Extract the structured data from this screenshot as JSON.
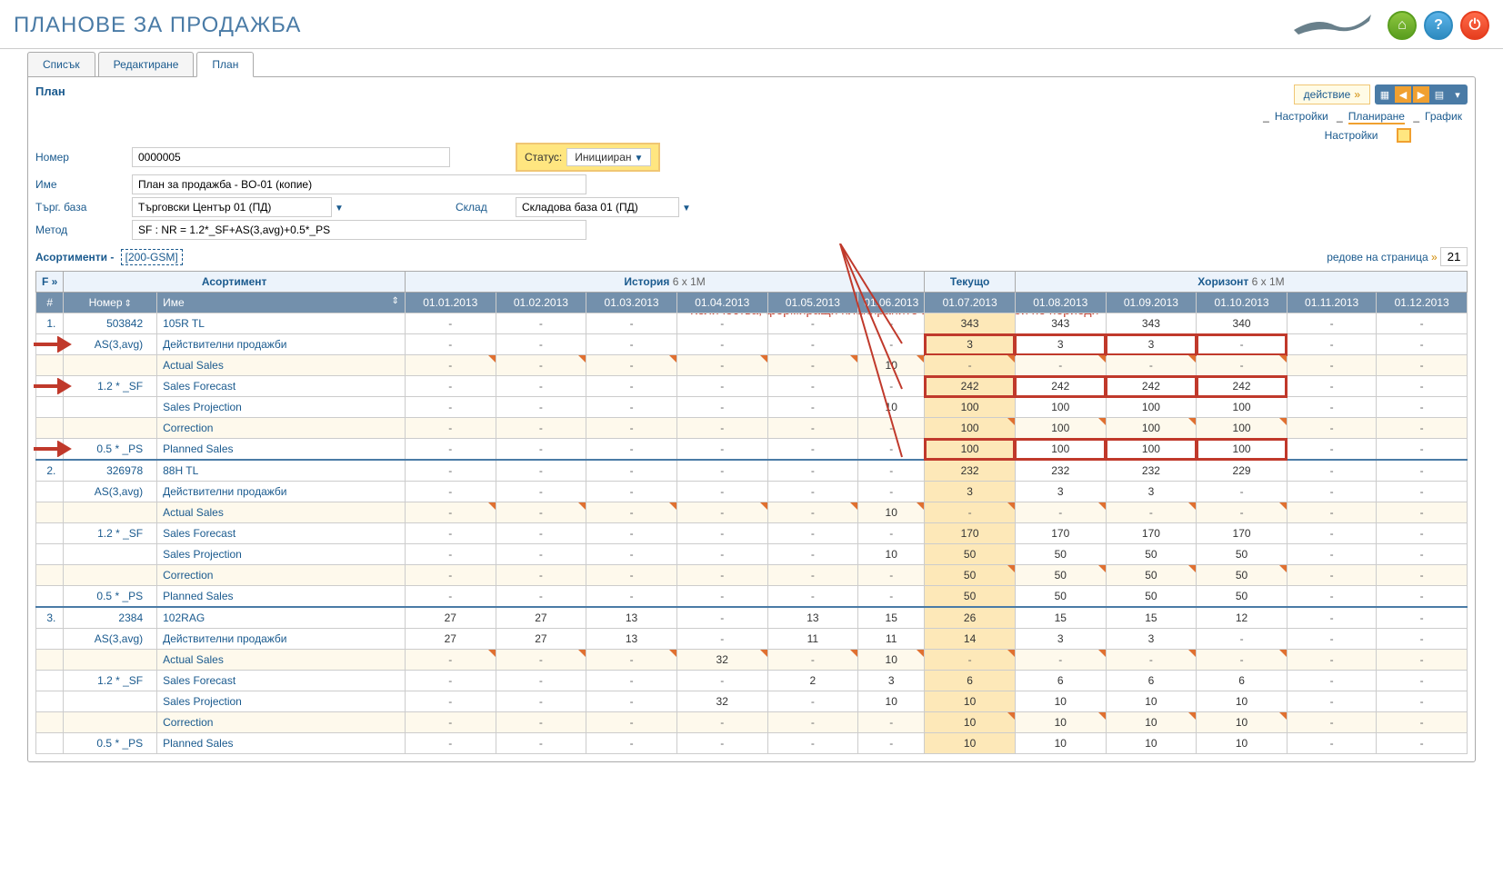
{
  "page_title": "ПЛАНОВЕ ЗА ПРОДАЖБА",
  "tabs": {
    "list": "Списък",
    "edit": "Редактиране",
    "plan": "План"
  },
  "plan_heading": "План",
  "action_btn": "действие",
  "form": {
    "number_lbl": "Номер",
    "number_val": "0000005",
    "status_lbl": "Статус:",
    "status_val": "Иницииран",
    "name_lbl": "Име",
    "name_val": "План за продажба - BO-01 (копие)",
    "base_lbl": "Търг. база",
    "base_val": "Търговски Център 01 (ПД)",
    "store_lbl": "Склад",
    "store_val": "Складова база 01 (ПД)",
    "method_lbl": "Метод",
    "method_val": "SF : NR = 1.2*_SF+AS(3,avg)+0.5*_PS"
  },
  "side": {
    "settings": "Настройки",
    "planning": "Планиране",
    "chart": "График",
    "settings2": "Настройки"
  },
  "annotation": "Количества, формиращи планираните цели за продажби по периоди",
  "assort": {
    "label": "Асортименти -",
    "filter": "[200-GSM]"
  },
  "rows_label": "редове на страница",
  "rows_val": "21",
  "headers": {
    "f": "F »",
    "assortment": "Асортимент",
    "history": "История",
    "history_suffix": "6 x 1M",
    "current": "Текущо",
    "horizon": "Хоризонт",
    "horizon_suffix": "6 x 1M",
    "hash": "#",
    "number": "Номер",
    "name": "Име",
    "months": [
      "01.01.2013",
      "01.02.2013",
      "01.03.2013",
      "01.04.2013",
      "01.05.2013",
      "01.06.2013",
      "01.07.2013",
      "01.08.2013",
      "01.09.2013",
      "01.10.2013",
      "01.11.2013",
      "01.12.2013"
    ]
  },
  "row_labels": {
    "as": "AS(3,avg)",
    "actual_sales_bg": "Действителни продажби",
    "actual_sales": "Actual Sales",
    "sf": "1.2 * _SF",
    "sales_forecast": "Sales Forecast",
    "sales_proj": "Sales Projection",
    "correction": "Correction",
    "ps": "0.5 * _PS",
    "planned": "Planned Sales"
  },
  "items": [
    {
      "n": "1.",
      "code": "503842",
      "name": "105R TL",
      "main": [
        "-",
        "-",
        "-",
        "-",
        "-",
        "-",
        "343",
        "343",
        "343",
        "340",
        "-",
        "-"
      ],
      "as": [
        "-",
        "-",
        "-",
        "-",
        "-",
        "-",
        "3",
        "3",
        "3",
        "-",
        "-",
        "-"
      ],
      "act": [
        "-",
        "-",
        "-",
        "-",
        "-",
        "10",
        "-",
        "-",
        "-",
        "-",
        "-",
        "-"
      ],
      "sf": [
        "-",
        "-",
        "-",
        "-",
        "-",
        "-",
        "242",
        "242",
        "242",
        "242",
        "-",
        "-"
      ],
      "sp": [
        "-",
        "-",
        "-",
        "-",
        "-",
        "10",
        "100",
        "100",
        "100",
        "100",
        "-",
        "-"
      ],
      "corr": [
        "-",
        "-",
        "-",
        "-",
        "-",
        "-",
        "100",
        "100",
        "100",
        "100",
        "-",
        "-"
      ],
      "ps": [
        "-",
        "-",
        "-",
        "-",
        "-",
        "-",
        "100",
        "100",
        "100",
        "100",
        "-",
        "-"
      ]
    },
    {
      "n": "2.",
      "code": "326978",
      "name": "88H TL",
      "main": [
        "-",
        "-",
        "-",
        "-",
        "-",
        "-",
        "232",
        "232",
        "232",
        "229",
        "-",
        "-"
      ],
      "as": [
        "-",
        "-",
        "-",
        "-",
        "-",
        "-",
        "3",
        "3",
        "3",
        "-",
        "-",
        "-"
      ],
      "act": [
        "-",
        "-",
        "-",
        "-",
        "-",
        "10",
        "-",
        "-",
        "-",
        "-",
        "-",
        "-"
      ],
      "sf": [
        "-",
        "-",
        "-",
        "-",
        "-",
        "-",
        "170",
        "170",
        "170",
        "170",
        "-",
        "-"
      ],
      "sp": [
        "-",
        "-",
        "-",
        "-",
        "-",
        "10",
        "50",
        "50",
        "50",
        "50",
        "-",
        "-"
      ],
      "corr": [
        "-",
        "-",
        "-",
        "-",
        "-",
        "-",
        "50",
        "50",
        "50",
        "50",
        "-",
        "-"
      ],
      "ps": [
        "-",
        "-",
        "-",
        "-",
        "-",
        "-",
        "50",
        "50",
        "50",
        "50",
        "-",
        "-"
      ]
    },
    {
      "n": "3.",
      "code": "2384",
      "name": "102RAG",
      "main": [
        "27",
        "27",
        "13",
        "-",
        "13",
        "15",
        "26",
        "15",
        "15",
        "12",
        "-",
        "-"
      ],
      "as": [
        "27",
        "27",
        "13",
        "-",
        "11",
        "11",
        "14",
        "3",
        "3",
        "-",
        "-",
        "-"
      ],
      "act": [
        "-",
        "-",
        "-",
        "32",
        "-",
        "10",
        "-",
        "-",
        "-",
        "-",
        "-",
        "-"
      ],
      "sf": [
        "-",
        "-",
        "-",
        "-",
        "2",
        "3",
        "6",
        "6",
        "6",
        "6",
        "-",
        "-"
      ],
      "sp": [
        "-",
        "-",
        "-",
        "32",
        "-",
        "10",
        "10",
        "10",
        "10",
        "10",
        "-",
        "-"
      ],
      "corr": [
        "-",
        "-",
        "-",
        "-",
        "-",
        "-",
        "10",
        "10",
        "10",
        "10",
        "-",
        "-"
      ],
      "ps": [
        "-",
        "-",
        "-",
        "-",
        "-",
        "-",
        "10",
        "10",
        "10",
        "10",
        "-",
        "-"
      ]
    }
  ]
}
